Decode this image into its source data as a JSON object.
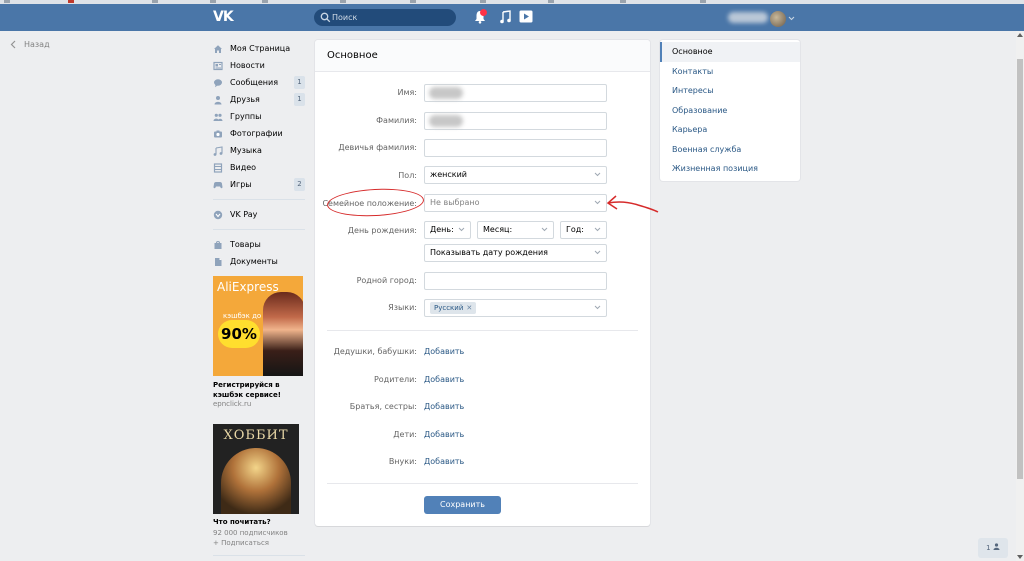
{
  "header": {
    "logo": "VK",
    "search_placeholder": "Поиск"
  },
  "back_label": "Назад",
  "left_nav": [
    {
      "label": "Моя Страница",
      "icon": "home-icon",
      "count": ""
    },
    {
      "label": "Новости",
      "icon": "news-icon",
      "count": ""
    },
    {
      "label": "Сообщения",
      "icon": "messages-icon",
      "count": "1"
    },
    {
      "label": "Друзья",
      "icon": "friends-icon",
      "count": "1"
    },
    {
      "label": "Группы",
      "icon": "groups-icon",
      "count": ""
    },
    {
      "label": "Фотографии",
      "icon": "camera-icon",
      "count": ""
    },
    {
      "label": "Музыка",
      "icon": "music-icon",
      "count": ""
    },
    {
      "label": "Видео",
      "icon": "video-icon",
      "count": ""
    },
    {
      "label": "Игры",
      "icon": "games-icon",
      "count": "2"
    },
    {
      "label": "VK Pay",
      "icon": "vkpay-icon",
      "count": ""
    },
    {
      "label": "Товары",
      "icon": "goods-icon",
      "count": ""
    },
    {
      "label": "Документы",
      "icon": "documents-icon",
      "count": ""
    }
  ],
  "ads": {
    "ad1": {
      "brand": "AliExpress",
      "subtitle": "кэшбэк до",
      "percent": "90%",
      "text": "Регистрируйся в кэшбэк сервисе!",
      "link": "epnclick.ru"
    },
    "ad2": {
      "poster_title": "ХОББИТ",
      "title": "Что почитать?",
      "subscribers": "92 000 подписчиков",
      "follow": "+ Подписаться"
    }
  },
  "form": {
    "title": "Основное",
    "first_name_label": "Имя:",
    "last_name_label": "Фамилия:",
    "maiden_label": "Девичья фамилия:",
    "maiden_value": "",
    "gender_label": "Пол:",
    "gender_value": "женский",
    "marital_label": "Семейное положение:",
    "marital_value": "Не выбрано",
    "birthday_label": "День рождения:",
    "day_value": "День:",
    "month_value": "Месяц:",
    "year_value": "Год:",
    "birthday_visibility": "Показывать дату рождения",
    "hometown_label": "Родной город:",
    "hometown_value": "",
    "languages_label": "Языки:",
    "language_token": "Русский",
    "relatives": [
      {
        "label": "Дедушки, бабушки:",
        "action": "Добавить"
      },
      {
        "label": "Родители:",
        "action": "Добавить"
      },
      {
        "label": "Братья, сестры:",
        "action": "Добавить"
      },
      {
        "label": "Дети:",
        "action": "Добавить"
      },
      {
        "label": "Внуки:",
        "action": "Добавить"
      }
    ],
    "save_label": "Сохранить"
  },
  "right_menu": [
    {
      "label": "Основное",
      "active": true
    },
    {
      "label": "Контакты",
      "active": false
    },
    {
      "label": "Интересы",
      "active": false
    },
    {
      "label": "Образование",
      "active": false
    },
    {
      "label": "Карьера",
      "active": false
    },
    {
      "label": "Военная служба",
      "active": false
    },
    {
      "label": "Жизненная позиция",
      "active": false
    }
  ],
  "chat_widget": "1",
  "colors": {
    "header": "#4a76a8",
    "link": "#2a5885",
    "button": "#5181b8",
    "annotation": "#d62b2b"
  }
}
